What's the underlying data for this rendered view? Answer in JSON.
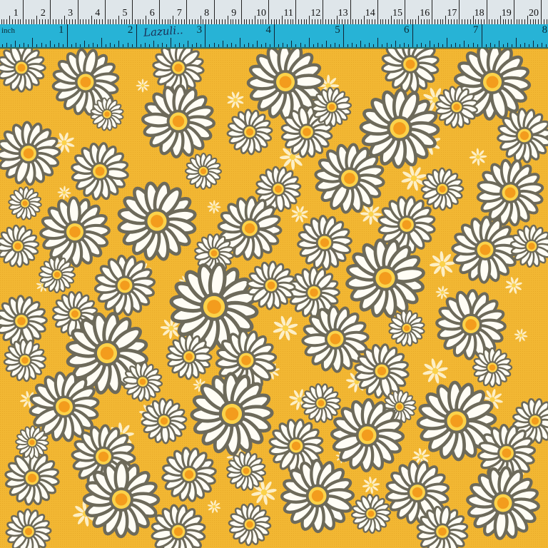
{
  "image": {
    "type": "photo",
    "subject": "yellow cotton fabric with white daisy print, rulers along top edge",
    "colors": {
      "fabric_background": "#f2b733",
      "petal": "#ffffff",
      "petal_outline": "#6d6a5a",
      "flower_center": "#f5a51e",
      "center_ring": "#fbd24a",
      "cm_ruler": "#dfe6ea",
      "inch_ruler": "#27b3d6"
    }
  },
  "ruler_cm": {
    "labels": [
      "1",
      "2",
      "3",
      "4",
      "5",
      "6",
      "7",
      "8",
      "9",
      "10",
      "11",
      "12",
      "13",
      "14",
      "15",
      "16",
      "17",
      "18",
      "19",
      "20"
    ]
  },
  "ruler_inch": {
    "unit_label": "inch",
    "handwritten": "Lazuli..",
    "labels": [
      "1",
      "2",
      "3",
      "4",
      "5",
      "6",
      "7",
      "8"
    ]
  }
}
